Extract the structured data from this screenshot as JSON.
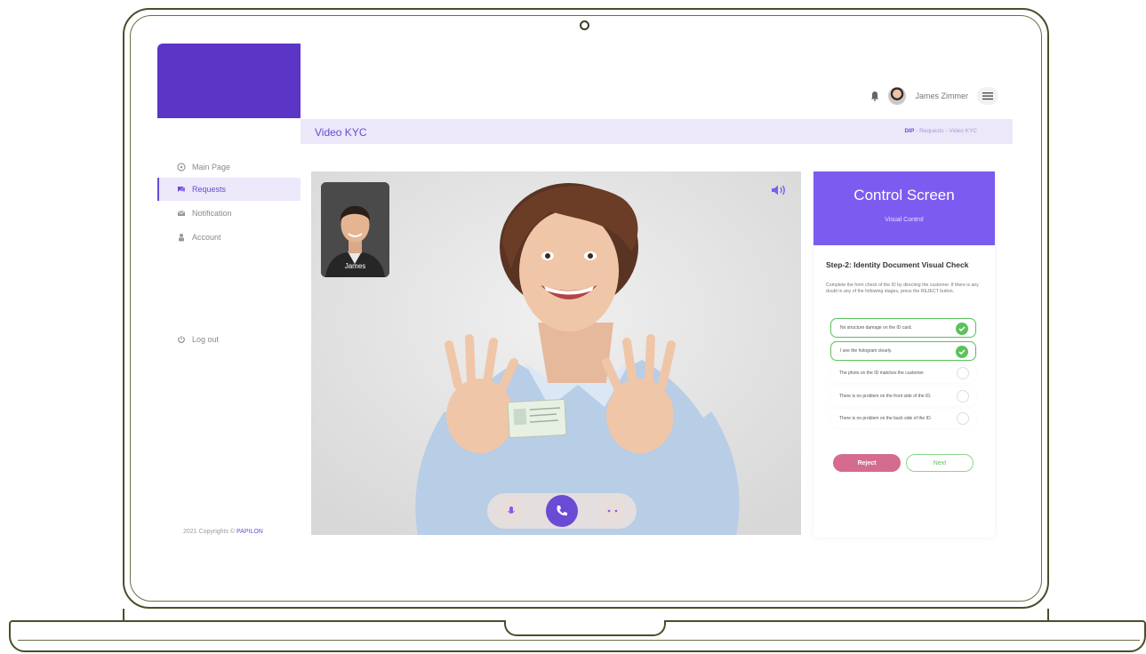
{
  "header": {
    "username": "James Zimmer"
  },
  "sidebar": {
    "items": [
      {
        "label": "Main Page",
        "icon": "dashboard-icon"
      },
      {
        "label": "Requests",
        "icon": "chat-icon",
        "active": true
      },
      {
        "label": "Notification",
        "icon": "mail-icon"
      },
      {
        "label": "Account",
        "icon": "user-icon"
      }
    ],
    "logout": "Log out",
    "copyright": "2021 Copyrights ©",
    "brand": "PAPILON"
  },
  "titlebar": {
    "title": "Video KYC",
    "breadcrumb_home": "DIP",
    "breadcrumb_path": "- Requests - Video KYC"
  },
  "video": {
    "pip_name": "James"
  },
  "panel": {
    "title": "Control Screen",
    "subtitle": "Visual Control",
    "step_title": "Step-2: Identity Document Visual Check",
    "step_desc": "Complete the form check of the ID by directing the customer. If there is any doubt in any of the following stages, press the REJECT button.",
    "checks": [
      {
        "label": "No structure damage on the ID card.",
        "done": true
      },
      {
        "label": "I see the hologram clearly.",
        "done": true
      },
      {
        "label": "The photo on the ID matches the customer.",
        "done": false
      },
      {
        "label": "There is no problem on the front side of the ID.",
        "done": false
      },
      {
        "label": "There is no problem on the back side of the ID.",
        "done": false
      }
    ],
    "reject_label": "Reject",
    "next_label": "Next"
  },
  "colors": {
    "accent": "#6a4bd6",
    "header_purple": "#7c5cf0",
    "success": "#5cc25c",
    "reject": "#d56b8e"
  }
}
